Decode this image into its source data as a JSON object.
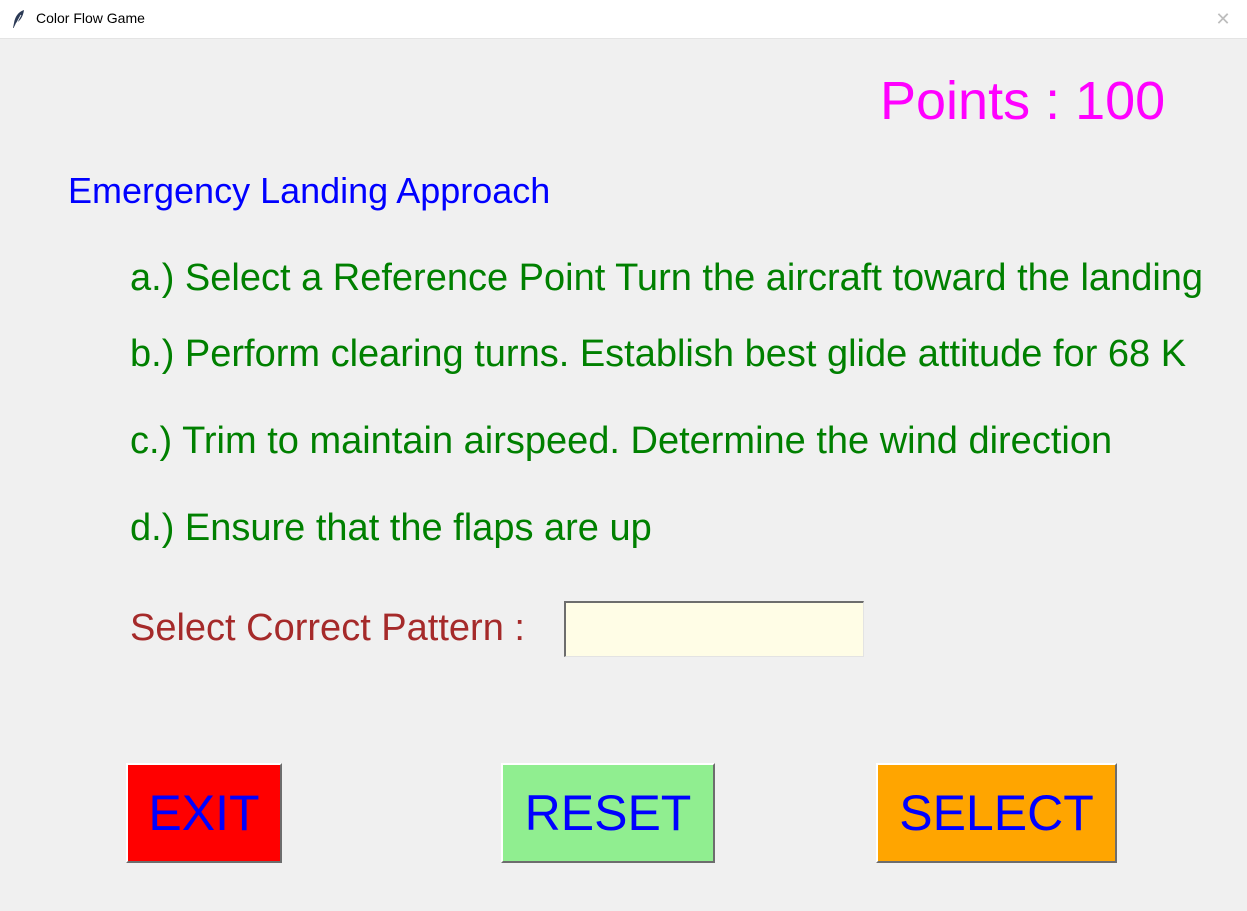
{
  "window": {
    "title": "Color Flow Game",
    "close_glyph": "✕"
  },
  "score": {
    "text": "Points : 100",
    "color": "#ff00ff"
  },
  "procedure": {
    "title": "Emergency Landing Approach",
    "title_color": "#0000ff",
    "step_color": "#008000",
    "steps": [
      "a.) Select a Reference Point Turn the aircraft toward the landing",
      "b.) Perform clearing turns. Establish best glide attitude for 68 K",
      "c.) Trim to maintain airspeed. Determine the wind direction",
      "d.) Ensure that the flaps are up"
    ]
  },
  "pattern": {
    "label": "Select Correct Pattern :",
    "label_color": "#a52a2a",
    "value": "",
    "input_bg": "#fffde6"
  },
  "buttons": {
    "text_color": "#0000ff",
    "exit": {
      "label": "EXIT",
      "bg": "#ff0000"
    },
    "reset": {
      "label": "RESET",
      "bg": "#90ee90"
    },
    "select": {
      "label": "SELECT",
      "bg": "#ffa500"
    }
  },
  "icons": {
    "app": "feather-icon",
    "close": "close-icon"
  }
}
